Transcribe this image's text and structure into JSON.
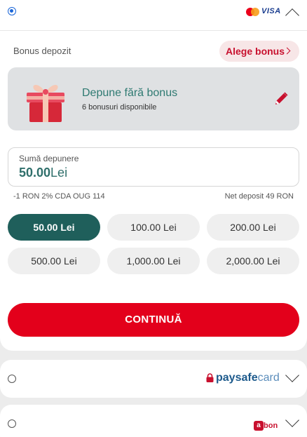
{
  "card_method": {
    "brands": [
      "mastercard",
      "VISA"
    ],
    "expanded": true,
    "selected": true
  },
  "bonus": {
    "section_label": "Bonus depozit",
    "choose_label": "Alege bonus",
    "title": "Depune fără bonus",
    "subtitle": "6 bonusuri disponibile",
    "gift_icon": "gift-icon",
    "edit_icon": "pencil-icon"
  },
  "amount": {
    "label": "Sumă depunere",
    "value": "50.00",
    "currency": "Lei",
    "fee_note": "-1 RON 2% CDA OUG 114",
    "net_note": "Net deposit 49 RON"
  },
  "presets": [
    {
      "label": "50.00 Lei",
      "active": true
    },
    {
      "label": "100.00 Lei",
      "active": false
    },
    {
      "label": "200.00 Lei",
      "active": false
    },
    {
      "label": "500.00 Lei",
      "active": false
    },
    {
      "label": "1,000.00 Lei",
      "active": false
    },
    {
      "label": "2,000.00 Lei",
      "active": false
    }
  ],
  "continue_label": "CONTINUĂ",
  "other_methods": [
    {
      "name": "paysafecard",
      "brand_parts": [
        "pay",
        "safe",
        "card"
      ]
    },
    {
      "name": "abon",
      "brand_parts": [
        "a",
        "bon"
      ]
    }
  ],
  "colors": {
    "accent_red": "#e3001b",
    "teal": "#1f5f5b",
    "bonus_text": "#2f7a72",
    "radio_blue": "#1a66d8"
  }
}
